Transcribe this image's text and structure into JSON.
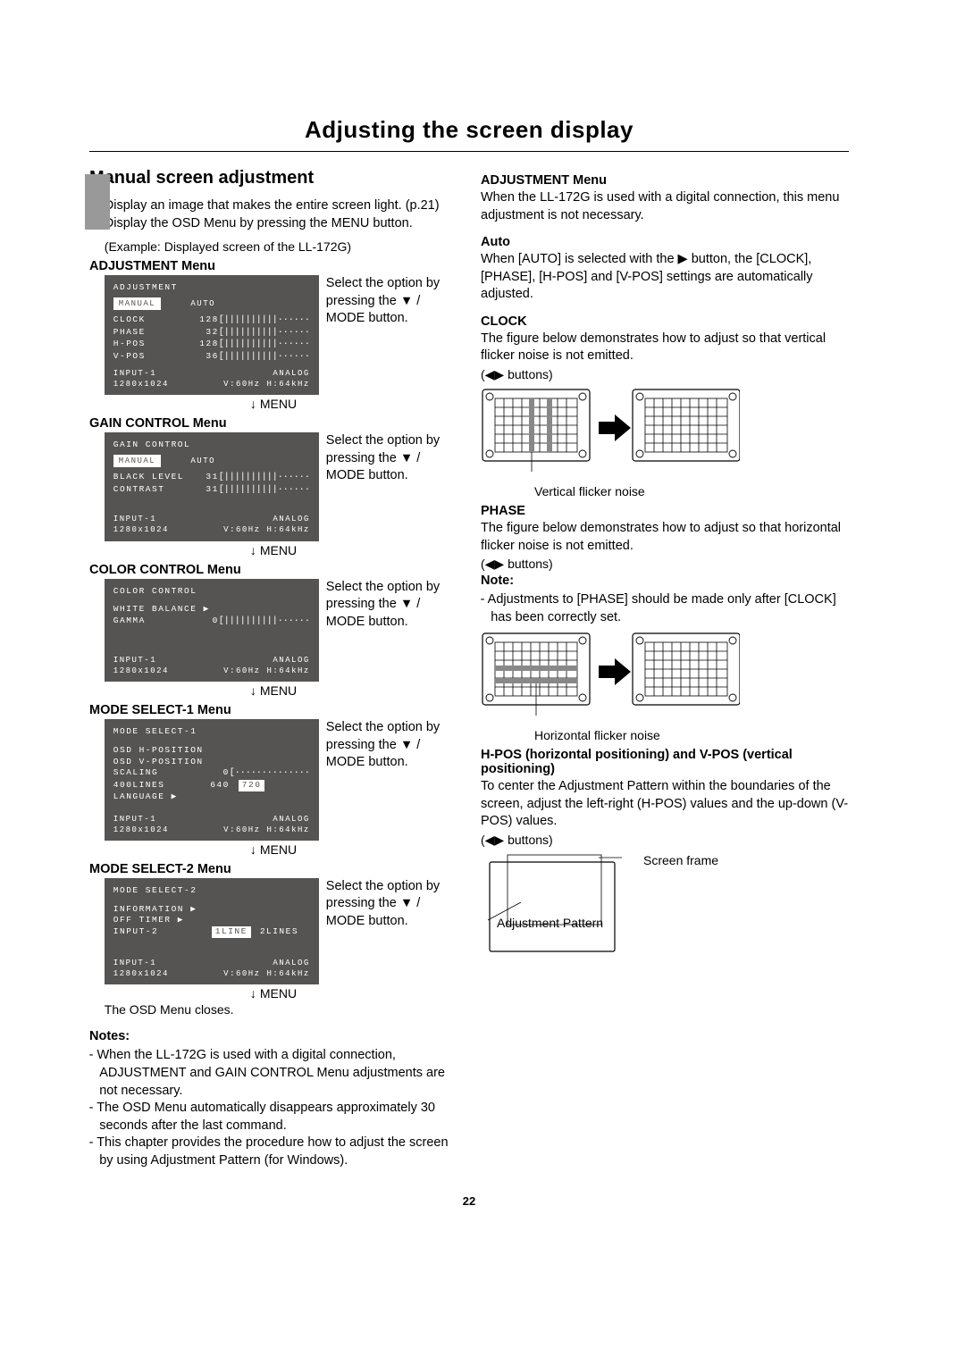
{
  "title": "Adjusting the screen display",
  "pagenum": "22",
  "left": {
    "heading": "Manual screen adjustment",
    "steps": [
      "Display an image that makes the entire screen light. (p.21)",
      "Display the OSD Menu by pressing the MENU button."
    ],
    "example": "(Example: Displayed screen of the LL-172G)",
    "menu_label": "MENU",
    "side_text": "Select the option by pressing the ▼ / MODE button.",
    "adj": {
      "title": "ADJUSTMENT Menu",
      "hdr": "ADJUSTMENT",
      "manual": "MANUAL",
      "auto": "AUTO",
      "rows": [
        {
          "lab": "CLOCK",
          "val": "128"
        },
        {
          "lab": "PHASE",
          "val": "32"
        },
        {
          "lab": "H-POS",
          "val": "128"
        },
        {
          "lab": "V-POS",
          "val": "36"
        }
      ],
      "ftr_l1": "INPUT-1",
      "ftr_r1": "ANALOG",
      "ftr_l2": "1280x1024",
      "ftr_r2": "V:60Hz  H:64kHz"
    },
    "gain": {
      "title": "GAIN CONTROL Menu",
      "hdr": "GAIN CONTROL",
      "manual": "MANUAL",
      "auto": "AUTO",
      "rows": [
        {
          "lab": "BLACK LEVEL",
          "val": "31"
        },
        {
          "lab": "CONTRAST",
          "val": "31"
        }
      ],
      "ftr_l1": "INPUT-1",
      "ftr_r1": "ANALOG",
      "ftr_l2": "1280x1024",
      "ftr_r2": "V:60Hz  H:64kHz"
    },
    "color": {
      "title": "COLOR CONTROL Menu",
      "hdr": "COLOR CONTROL",
      "wb": "WHITE BALANCE ▶",
      "gamma_lab": "GAMMA",
      "gamma_val": "0",
      "ftr_l1": "INPUT-1",
      "ftr_r1": "ANALOG",
      "ftr_l2": "1280x1024",
      "ftr_r2": "V:60Hz  H:64kHz"
    },
    "ms1": {
      "title": "MODE SELECT-1 Menu",
      "hdr": "MODE SELECT-1",
      "r1": "OSD H-POSITION",
      "r2": "OSD V-POSITION",
      "r3": "SCALING",
      "r3v": "0",
      "r4": "400LINES",
      "r4a": "640",
      "r4b": "720",
      "r5": "LANGUAGE ▶",
      "ftr_l1": "INPUT-1",
      "ftr_r1": "ANALOG",
      "ftr_l2": "1280x1024",
      "ftr_r2": "V:60Hz  H:64kHz"
    },
    "ms2": {
      "title": "MODE SELECT-2 Menu",
      "hdr": "MODE SELECT-2",
      "r1": "INFORMATION ▶",
      "r2": "OFF TIMER ▶",
      "r3": "INPUT-2",
      "r3a": "1LINE",
      "r3b": "2LINES",
      "ftr_l1": "INPUT-1",
      "ftr_r1": "ANALOG",
      "ftr_l2": "1280x1024",
      "ftr_r2": "V:60Hz  H:64kHz"
    },
    "close_text": "The OSD Menu closes.",
    "notes_heading": "Notes:",
    "notes": [
      "When the LL-172G is used with a digital connection, ADJUSTMENT and GAIN CONTROL Menu adjustments are not necessary.",
      "The OSD Menu automatically disappears approximately 30 seconds after the last command.",
      "This chapter provides the procedure how to adjust the screen by using Adjustment Pattern (for Windows)."
    ]
  },
  "right": {
    "adj_heading": "ADJUSTMENT Menu",
    "adj_text": "When the LL-172G is used with a digital connection, this menu adjustment is not necessary.",
    "auto_heading": "Auto",
    "auto_text": "When [AUTO] is selected with the ▶ button, the [CLOCK], [PHASE], [H-POS] and [V-POS] settings are automatically adjusted.",
    "clock_heading": "CLOCK",
    "clock_text": "The figure below demonstrates how to adjust so that vertical flicker noise is not emitted.",
    "lr_label": "buttons",
    "clock_caption": "Vertical flicker noise",
    "phase_heading": "PHASE",
    "phase_text": "The figure below demonstrates how to adjust so that horizontal flicker noise is not emitted.",
    "phase_note_heading": "Note:",
    "phase_note": "Adjustments to [PHASE] should be made only after [CLOCK] has been correctly set.",
    "phase_caption": "Horizontal flicker noise",
    "hpos_heading": "H-POS (horizontal positioning) and V-POS (vertical positioning)",
    "hpos_text": "To center the Adjustment Pattern within the boundaries of the screen, adjust the left-right (H-POS) values and the up-down (V-POS) values.",
    "screen_frame": "Screen frame",
    "adj_pattern": "Adjustment Pattern"
  }
}
